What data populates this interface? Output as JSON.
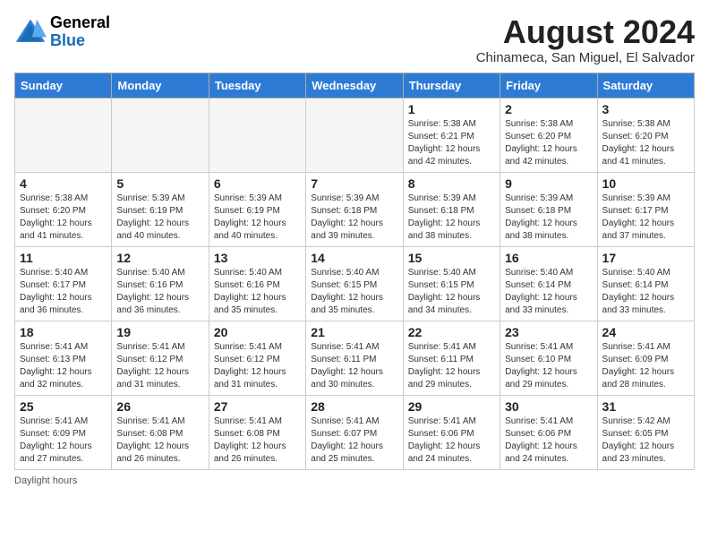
{
  "header": {
    "logo_general": "General",
    "logo_blue": "Blue",
    "month_year": "August 2024",
    "location": "Chinameca, San Miguel, El Salvador"
  },
  "days_of_week": [
    "Sunday",
    "Monday",
    "Tuesday",
    "Wednesday",
    "Thursday",
    "Friday",
    "Saturday"
  ],
  "weeks": [
    [
      {
        "day": "",
        "info": ""
      },
      {
        "day": "",
        "info": ""
      },
      {
        "day": "",
        "info": ""
      },
      {
        "day": "",
        "info": ""
      },
      {
        "day": "1",
        "info": "Sunrise: 5:38 AM\nSunset: 6:21 PM\nDaylight: 12 hours\nand 42 minutes."
      },
      {
        "day": "2",
        "info": "Sunrise: 5:38 AM\nSunset: 6:20 PM\nDaylight: 12 hours\nand 42 minutes."
      },
      {
        "day": "3",
        "info": "Sunrise: 5:38 AM\nSunset: 6:20 PM\nDaylight: 12 hours\nand 41 minutes."
      }
    ],
    [
      {
        "day": "4",
        "info": "Sunrise: 5:38 AM\nSunset: 6:20 PM\nDaylight: 12 hours\nand 41 minutes."
      },
      {
        "day": "5",
        "info": "Sunrise: 5:39 AM\nSunset: 6:19 PM\nDaylight: 12 hours\nand 40 minutes."
      },
      {
        "day": "6",
        "info": "Sunrise: 5:39 AM\nSunset: 6:19 PM\nDaylight: 12 hours\nand 40 minutes."
      },
      {
        "day": "7",
        "info": "Sunrise: 5:39 AM\nSunset: 6:18 PM\nDaylight: 12 hours\nand 39 minutes."
      },
      {
        "day": "8",
        "info": "Sunrise: 5:39 AM\nSunset: 6:18 PM\nDaylight: 12 hours\nand 38 minutes."
      },
      {
        "day": "9",
        "info": "Sunrise: 5:39 AM\nSunset: 6:18 PM\nDaylight: 12 hours\nand 38 minutes."
      },
      {
        "day": "10",
        "info": "Sunrise: 5:39 AM\nSunset: 6:17 PM\nDaylight: 12 hours\nand 37 minutes."
      }
    ],
    [
      {
        "day": "11",
        "info": "Sunrise: 5:40 AM\nSunset: 6:17 PM\nDaylight: 12 hours\nand 36 minutes."
      },
      {
        "day": "12",
        "info": "Sunrise: 5:40 AM\nSunset: 6:16 PM\nDaylight: 12 hours\nand 36 minutes."
      },
      {
        "day": "13",
        "info": "Sunrise: 5:40 AM\nSunset: 6:16 PM\nDaylight: 12 hours\nand 35 minutes."
      },
      {
        "day": "14",
        "info": "Sunrise: 5:40 AM\nSunset: 6:15 PM\nDaylight: 12 hours\nand 35 minutes."
      },
      {
        "day": "15",
        "info": "Sunrise: 5:40 AM\nSunset: 6:15 PM\nDaylight: 12 hours\nand 34 minutes."
      },
      {
        "day": "16",
        "info": "Sunrise: 5:40 AM\nSunset: 6:14 PM\nDaylight: 12 hours\nand 33 minutes."
      },
      {
        "day": "17",
        "info": "Sunrise: 5:40 AM\nSunset: 6:14 PM\nDaylight: 12 hours\nand 33 minutes."
      }
    ],
    [
      {
        "day": "18",
        "info": "Sunrise: 5:41 AM\nSunset: 6:13 PM\nDaylight: 12 hours\nand 32 minutes."
      },
      {
        "day": "19",
        "info": "Sunrise: 5:41 AM\nSunset: 6:12 PM\nDaylight: 12 hours\nand 31 minutes."
      },
      {
        "day": "20",
        "info": "Sunrise: 5:41 AM\nSunset: 6:12 PM\nDaylight: 12 hours\nand 31 minutes."
      },
      {
        "day": "21",
        "info": "Sunrise: 5:41 AM\nSunset: 6:11 PM\nDaylight: 12 hours\nand 30 minutes."
      },
      {
        "day": "22",
        "info": "Sunrise: 5:41 AM\nSunset: 6:11 PM\nDaylight: 12 hours\nand 29 minutes."
      },
      {
        "day": "23",
        "info": "Sunrise: 5:41 AM\nSunset: 6:10 PM\nDaylight: 12 hours\nand 29 minutes."
      },
      {
        "day": "24",
        "info": "Sunrise: 5:41 AM\nSunset: 6:09 PM\nDaylight: 12 hours\nand 28 minutes."
      }
    ],
    [
      {
        "day": "25",
        "info": "Sunrise: 5:41 AM\nSunset: 6:09 PM\nDaylight: 12 hours\nand 27 minutes."
      },
      {
        "day": "26",
        "info": "Sunrise: 5:41 AM\nSunset: 6:08 PM\nDaylight: 12 hours\nand 26 minutes."
      },
      {
        "day": "27",
        "info": "Sunrise: 5:41 AM\nSunset: 6:08 PM\nDaylight: 12 hours\nand 26 minutes."
      },
      {
        "day": "28",
        "info": "Sunrise: 5:41 AM\nSunset: 6:07 PM\nDaylight: 12 hours\nand 25 minutes."
      },
      {
        "day": "29",
        "info": "Sunrise: 5:41 AM\nSunset: 6:06 PM\nDaylight: 12 hours\nand 24 minutes."
      },
      {
        "day": "30",
        "info": "Sunrise: 5:41 AM\nSunset: 6:06 PM\nDaylight: 12 hours\nand 24 minutes."
      },
      {
        "day": "31",
        "info": "Sunrise: 5:42 AM\nSunset: 6:05 PM\nDaylight: 12 hours\nand 23 minutes."
      }
    ]
  ],
  "footer": {
    "daylight_hours_label": "Daylight hours"
  }
}
